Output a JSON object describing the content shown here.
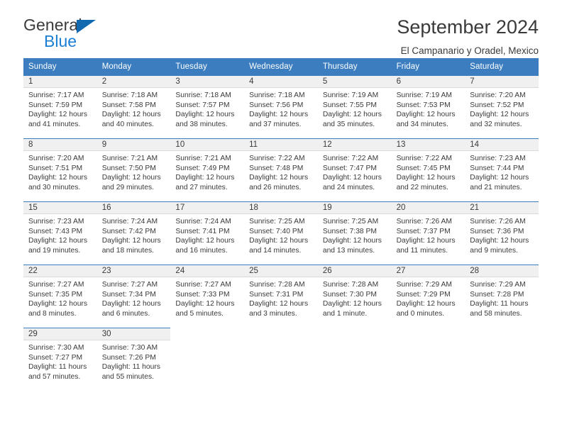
{
  "brand": {
    "name_part1": "General",
    "name_part2": "Blue",
    "accent_color": "#1269b0",
    "blue_text_color": "#1a7fd4"
  },
  "header": {
    "title": "September 2024",
    "subtitle": "El Campanario y Oradel, Mexico"
  },
  "calendar": {
    "header_bg": "#3b7dbf",
    "weekdays": [
      "Sunday",
      "Monday",
      "Tuesday",
      "Wednesday",
      "Thursday",
      "Friday",
      "Saturday"
    ],
    "weeks": [
      [
        {
          "day": "1",
          "sunrise": "Sunrise: 7:17 AM",
          "sunset": "Sunset: 7:59 PM",
          "daylight1": "Daylight: 12 hours",
          "daylight2": "and 41 minutes."
        },
        {
          "day": "2",
          "sunrise": "Sunrise: 7:18 AM",
          "sunset": "Sunset: 7:58 PM",
          "daylight1": "Daylight: 12 hours",
          "daylight2": "and 40 minutes."
        },
        {
          "day": "3",
          "sunrise": "Sunrise: 7:18 AM",
          "sunset": "Sunset: 7:57 PM",
          "daylight1": "Daylight: 12 hours",
          "daylight2": "and 38 minutes."
        },
        {
          "day": "4",
          "sunrise": "Sunrise: 7:18 AM",
          "sunset": "Sunset: 7:56 PM",
          "daylight1": "Daylight: 12 hours",
          "daylight2": "and 37 minutes."
        },
        {
          "day": "5",
          "sunrise": "Sunrise: 7:19 AM",
          "sunset": "Sunset: 7:55 PM",
          "daylight1": "Daylight: 12 hours",
          "daylight2": "and 35 minutes."
        },
        {
          "day": "6",
          "sunrise": "Sunrise: 7:19 AM",
          "sunset": "Sunset: 7:53 PM",
          "daylight1": "Daylight: 12 hours",
          "daylight2": "and 34 minutes."
        },
        {
          "day": "7",
          "sunrise": "Sunrise: 7:20 AM",
          "sunset": "Sunset: 7:52 PM",
          "daylight1": "Daylight: 12 hours",
          "daylight2": "and 32 minutes."
        }
      ],
      [
        {
          "day": "8",
          "sunrise": "Sunrise: 7:20 AM",
          "sunset": "Sunset: 7:51 PM",
          "daylight1": "Daylight: 12 hours",
          "daylight2": "and 30 minutes."
        },
        {
          "day": "9",
          "sunrise": "Sunrise: 7:21 AM",
          "sunset": "Sunset: 7:50 PM",
          "daylight1": "Daylight: 12 hours",
          "daylight2": "and 29 minutes."
        },
        {
          "day": "10",
          "sunrise": "Sunrise: 7:21 AM",
          "sunset": "Sunset: 7:49 PM",
          "daylight1": "Daylight: 12 hours",
          "daylight2": "and 27 minutes."
        },
        {
          "day": "11",
          "sunrise": "Sunrise: 7:22 AM",
          "sunset": "Sunset: 7:48 PM",
          "daylight1": "Daylight: 12 hours",
          "daylight2": "and 26 minutes."
        },
        {
          "day": "12",
          "sunrise": "Sunrise: 7:22 AM",
          "sunset": "Sunset: 7:47 PM",
          "daylight1": "Daylight: 12 hours",
          "daylight2": "and 24 minutes."
        },
        {
          "day": "13",
          "sunrise": "Sunrise: 7:22 AM",
          "sunset": "Sunset: 7:45 PM",
          "daylight1": "Daylight: 12 hours",
          "daylight2": "and 22 minutes."
        },
        {
          "day": "14",
          "sunrise": "Sunrise: 7:23 AM",
          "sunset": "Sunset: 7:44 PM",
          "daylight1": "Daylight: 12 hours",
          "daylight2": "and 21 minutes."
        }
      ],
      [
        {
          "day": "15",
          "sunrise": "Sunrise: 7:23 AM",
          "sunset": "Sunset: 7:43 PM",
          "daylight1": "Daylight: 12 hours",
          "daylight2": "and 19 minutes."
        },
        {
          "day": "16",
          "sunrise": "Sunrise: 7:24 AM",
          "sunset": "Sunset: 7:42 PM",
          "daylight1": "Daylight: 12 hours",
          "daylight2": "and 18 minutes."
        },
        {
          "day": "17",
          "sunrise": "Sunrise: 7:24 AM",
          "sunset": "Sunset: 7:41 PM",
          "daylight1": "Daylight: 12 hours",
          "daylight2": "and 16 minutes."
        },
        {
          "day": "18",
          "sunrise": "Sunrise: 7:25 AM",
          "sunset": "Sunset: 7:40 PM",
          "daylight1": "Daylight: 12 hours",
          "daylight2": "and 14 minutes."
        },
        {
          "day": "19",
          "sunrise": "Sunrise: 7:25 AM",
          "sunset": "Sunset: 7:38 PM",
          "daylight1": "Daylight: 12 hours",
          "daylight2": "and 13 minutes."
        },
        {
          "day": "20",
          "sunrise": "Sunrise: 7:26 AM",
          "sunset": "Sunset: 7:37 PM",
          "daylight1": "Daylight: 12 hours",
          "daylight2": "and 11 minutes."
        },
        {
          "day": "21",
          "sunrise": "Sunrise: 7:26 AM",
          "sunset": "Sunset: 7:36 PM",
          "daylight1": "Daylight: 12 hours",
          "daylight2": "and 9 minutes."
        }
      ],
      [
        {
          "day": "22",
          "sunrise": "Sunrise: 7:27 AM",
          "sunset": "Sunset: 7:35 PM",
          "daylight1": "Daylight: 12 hours",
          "daylight2": "and 8 minutes."
        },
        {
          "day": "23",
          "sunrise": "Sunrise: 7:27 AM",
          "sunset": "Sunset: 7:34 PM",
          "daylight1": "Daylight: 12 hours",
          "daylight2": "and 6 minutes."
        },
        {
          "day": "24",
          "sunrise": "Sunrise: 7:27 AM",
          "sunset": "Sunset: 7:33 PM",
          "daylight1": "Daylight: 12 hours",
          "daylight2": "and 5 minutes."
        },
        {
          "day": "25",
          "sunrise": "Sunrise: 7:28 AM",
          "sunset": "Sunset: 7:31 PM",
          "daylight1": "Daylight: 12 hours",
          "daylight2": "and 3 minutes."
        },
        {
          "day": "26",
          "sunrise": "Sunrise: 7:28 AM",
          "sunset": "Sunset: 7:30 PM",
          "daylight1": "Daylight: 12 hours",
          "daylight2": "and 1 minute."
        },
        {
          "day": "27",
          "sunrise": "Sunrise: 7:29 AM",
          "sunset": "Sunset: 7:29 PM",
          "daylight1": "Daylight: 12 hours",
          "daylight2": "and 0 minutes."
        },
        {
          "day": "28",
          "sunrise": "Sunrise: 7:29 AM",
          "sunset": "Sunset: 7:28 PM",
          "daylight1": "Daylight: 11 hours",
          "daylight2": "and 58 minutes."
        }
      ],
      [
        {
          "day": "29",
          "sunrise": "Sunrise: 7:30 AM",
          "sunset": "Sunset: 7:27 PM",
          "daylight1": "Daylight: 11 hours",
          "daylight2": "and 57 minutes."
        },
        {
          "day": "30",
          "sunrise": "Sunrise: 7:30 AM",
          "sunset": "Sunset: 7:26 PM",
          "daylight1": "Daylight: 11 hours",
          "daylight2": "and 55 minutes."
        },
        {
          "day": "",
          "sunrise": "",
          "sunset": "",
          "daylight1": "",
          "daylight2": ""
        },
        {
          "day": "",
          "sunrise": "",
          "sunset": "",
          "daylight1": "",
          "daylight2": ""
        },
        {
          "day": "",
          "sunrise": "",
          "sunset": "",
          "daylight1": "",
          "daylight2": ""
        },
        {
          "day": "",
          "sunrise": "",
          "sunset": "",
          "daylight1": "",
          "daylight2": ""
        },
        {
          "day": "",
          "sunrise": "",
          "sunset": "",
          "daylight1": "",
          "daylight2": ""
        }
      ]
    ]
  }
}
